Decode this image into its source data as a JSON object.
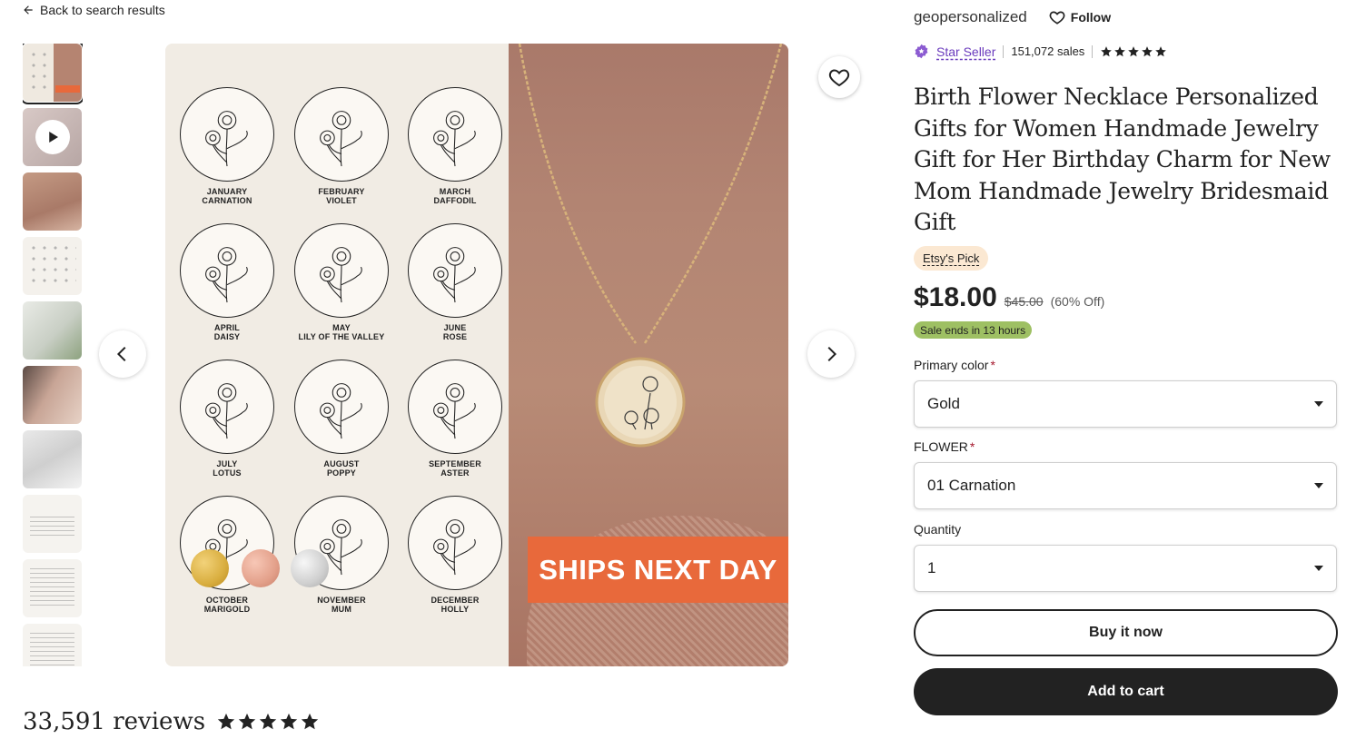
{
  "nav": {
    "back_label": "Back to search results"
  },
  "gallery": {
    "thumbnail_count": 10,
    "active_index": 0,
    "video_index": 1
  },
  "image": {
    "flowers": [
      {
        "month": "JANUARY",
        "name": "CARNATION"
      },
      {
        "month": "FEBRUARY",
        "name": "VIOLET"
      },
      {
        "month": "MARCH",
        "name": "DAFFODIL"
      },
      {
        "month": "APRIL",
        "name": "DAISY"
      },
      {
        "month": "MAY",
        "name": "LILY OF THE VALLEY"
      },
      {
        "month": "JUNE",
        "name": "ROSE"
      },
      {
        "month": "JULY",
        "name": "LOTUS"
      },
      {
        "month": "AUGUST",
        "name": "POPPY"
      },
      {
        "month": "SEPTEMBER",
        "name": "ASTER"
      },
      {
        "month": "OCTOBER",
        "name": "MARIGOLD"
      },
      {
        "month": "NOVEMBER",
        "name": "MUM"
      },
      {
        "month": "DECEMBER",
        "name": "HOLLY"
      }
    ],
    "badge_text": "SHIPS NEXT DAY",
    "swatch_colors": [
      "#d9ae3f",
      "#e3a08a",
      "#cfcfcf"
    ],
    "badge_color": "#e8693b"
  },
  "reviews": {
    "count_label": "33,591 reviews",
    "rating": 5
  },
  "shop": {
    "name": "geopersonalized",
    "follow_label": "Follow",
    "star_seller_label": "Star Seller",
    "sales_label": "151,072 sales",
    "rating": 5
  },
  "product": {
    "title": "Birth Flower Necklace Personalized Gifts for Women Handmade Jewelry Gift for Her Birthday Charm for New Mom Handmade Jewelry Bridesmaid Gift",
    "pick_badge": "Etsy's Pick",
    "price": "$18.00",
    "original_price": "$45.00",
    "discount": "(60% Off)",
    "sale_badge": "Sale ends in 13 hours"
  },
  "options": {
    "color": {
      "label": "Primary color",
      "required": "*",
      "value": "Gold"
    },
    "flower": {
      "label": "FLOWER",
      "required": "*",
      "value": "01 Carnation"
    },
    "quantity": {
      "label": "Quantity",
      "value": "1"
    }
  },
  "actions": {
    "buy_now_label": "Buy it now",
    "add_to_cart_label": "Add to cart"
  },
  "colors": {
    "text": "#222222",
    "star_seller": "#6a3bbd",
    "sale_badge": "#9ec063",
    "pick_badge": "#fbe8d2",
    "required": "#a61a2e"
  }
}
